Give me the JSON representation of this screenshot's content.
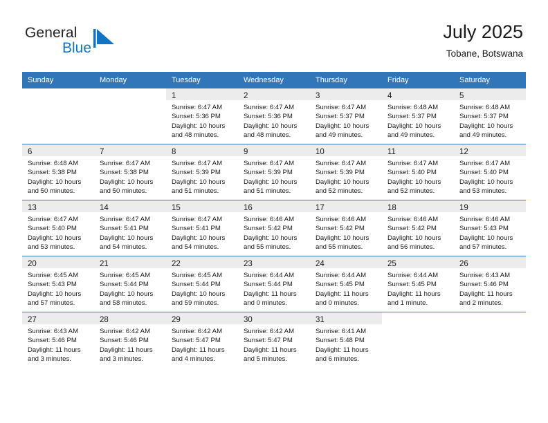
{
  "brand": {
    "name_top": "General",
    "name_bottom": "Blue",
    "color_top": "#231f20",
    "color_bottom": "#1474c4",
    "mark_color": "#1474c4"
  },
  "header": {
    "title": "July 2025",
    "subtitle": "Tobane, Botswana"
  },
  "theme": {
    "header_bg": "#3176b9",
    "header_text": "#ffffff",
    "daynum_band_bg": "#ececec",
    "row_divider": "#3176b9",
    "body_text": "#1a1a1a"
  },
  "weekdays": [
    "Sunday",
    "Monday",
    "Tuesday",
    "Wednesday",
    "Thursday",
    "Friday",
    "Saturday"
  ],
  "weeks": [
    [
      {
        "day": "",
        "sunrise": "",
        "sunset": "",
        "daylight_1": "",
        "daylight_2": ""
      },
      {
        "day": "",
        "sunrise": "",
        "sunset": "",
        "daylight_1": "",
        "daylight_2": ""
      },
      {
        "day": "1",
        "sunrise": "Sunrise: 6:47 AM",
        "sunset": "Sunset: 5:36 PM",
        "daylight_1": "Daylight: 10 hours",
        "daylight_2": "and 48 minutes."
      },
      {
        "day": "2",
        "sunrise": "Sunrise: 6:47 AM",
        "sunset": "Sunset: 5:36 PM",
        "daylight_1": "Daylight: 10 hours",
        "daylight_2": "and 48 minutes."
      },
      {
        "day": "3",
        "sunrise": "Sunrise: 6:47 AM",
        "sunset": "Sunset: 5:37 PM",
        "daylight_1": "Daylight: 10 hours",
        "daylight_2": "and 49 minutes."
      },
      {
        "day": "4",
        "sunrise": "Sunrise: 6:48 AM",
        "sunset": "Sunset: 5:37 PM",
        "daylight_1": "Daylight: 10 hours",
        "daylight_2": "and 49 minutes."
      },
      {
        "day": "5",
        "sunrise": "Sunrise: 6:48 AM",
        "sunset": "Sunset: 5:37 PM",
        "daylight_1": "Daylight: 10 hours",
        "daylight_2": "and 49 minutes."
      }
    ],
    [
      {
        "day": "6",
        "sunrise": "Sunrise: 6:48 AM",
        "sunset": "Sunset: 5:38 PM",
        "daylight_1": "Daylight: 10 hours",
        "daylight_2": "and 50 minutes."
      },
      {
        "day": "7",
        "sunrise": "Sunrise: 6:47 AM",
        "sunset": "Sunset: 5:38 PM",
        "daylight_1": "Daylight: 10 hours",
        "daylight_2": "and 50 minutes."
      },
      {
        "day": "8",
        "sunrise": "Sunrise: 6:47 AM",
        "sunset": "Sunset: 5:39 PM",
        "daylight_1": "Daylight: 10 hours",
        "daylight_2": "and 51 minutes."
      },
      {
        "day": "9",
        "sunrise": "Sunrise: 6:47 AM",
        "sunset": "Sunset: 5:39 PM",
        "daylight_1": "Daylight: 10 hours",
        "daylight_2": "and 51 minutes."
      },
      {
        "day": "10",
        "sunrise": "Sunrise: 6:47 AM",
        "sunset": "Sunset: 5:39 PM",
        "daylight_1": "Daylight: 10 hours",
        "daylight_2": "and 52 minutes."
      },
      {
        "day": "11",
        "sunrise": "Sunrise: 6:47 AM",
        "sunset": "Sunset: 5:40 PM",
        "daylight_1": "Daylight: 10 hours",
        "daylight_2": "and 52 minutes."
      },
      {
        "day": "12",
        "sunrise": "Sunrise: 6:47 AM",
        "sunset": "Sunset: 5:40 PM",
        "daylight_1": "Daylight: 10 hours",
        "daylight_2": "and 53 minutes."
      }
    ],
    [
      {
        "day": "13",
        "sunrise": "Sunrise: 6:47 AM",
        "sunset": "Sunset: 5:40 PM",
        "daylight_1": "Daylight: 10 hours",
        "daylight_2": "and 53 minutes."
      },
      {
        "day": "14",
        "sunrise": "Sunrise: 6:47 AM",
        "sunset": "Sunset: 5:41 PM",
        "daylight_1": "Daylight: 10 hours",
        "daylight_2": "and 54 minutes."
      },
      {
        "day": "15",
        "sunrise": "Sunrise: 6:47 AM",
        "sunset": "Sunset: 5:41 PM",
        "daylight_1": "Daylight: 10 hours",
        "daylight_2": "and 54 minutes."
      },
      {
        "day": "16",
        "sunrise": "Sunrise: 6:46 AM",
        "sunset": "Sunset: 5:42 PM",
        "daylight_1": "Daylight: 10 hours",
        "daylight_2": "and 55 minutes."
      },
      {
        "day": "17",
        "sunrise": "Sunrise: 6:46 AM",
        "sunset": "Sunset: 5:42 PM",
        "daylight_1": "Daylight: 10 hours",
        "daylight_2": "and 55 minutes."
      },
      {
        "day": "18",
        "sunrise": "Sunrise: 6:46 AM",
        "sunset": "Sunset: 5:42 PM",
        "daylight_1": "Daylight: 10 hours",
        "daylight_2": "and 56 minutes."
      },
      {
        "day": "19",
        "sunrise": "Sunrise: 6:46 AM",
        "sunset": "Sunset: 5:43 PM",
        "daylight_1": "Daylight: 10 hours",
        "daylight_2": "and 57 minutes."
      }
    ],
    [
      {
        "day": "20",
        "sunrise": "Sunrise: 6:45 AM",
        "sunset": "Sunset: 5:43 PM",
        "daylight_1": "Daylight: 10 hours",
        "daylight_2": "and 57 minutes."
      },
      {
        "day": "21",
        "sunrise": "Sunrise: 6:45 AM",
        "sunset": "Sunset: 5:44 PM",
        "daylight_1": "Daylight: 10 hours",
        "daylight_2": "and 58 minutes."
      },
      {
        "day": "22",
        "sunrise": "Sunrise: 6:45 AM",
        "sunset": "Sunset: 5:44 PM",
        "daylight_1": "Daylight: 10 hours",
        "daylight_2": "and 59 minutes."
      },
      {
        "day": "23",
        "sunrise": "Sunrise: 6:44 AM",
        "sunset": "Sunset: 5:44 PM",
        "daylight_1": "Daylight: 11 hours",
        "daylight_2": "and 0 minutes."
      },
      {
        "day": "24",
        "sunrise": "Sunrise: 6:44 AM",
        "sunset": "Sunset: 5:45 PM",
        "daylight_1": "Daylight: 11 hours",
        "daylight_2": "and 0 minutes."
      },
      {
        "day": "25",
        "sunrise": "Sunrise: 6:44 AM",
        "sunset": "Sunset: 5:45 PM",
        "daylight_1": "Daylight: 11 hours",
        "daylight_2": "and 1 minute."
      },
      {
        "day": "26",
        "sunrise": "Sunrise: 6:43 AM",
        "sunset": "Sunset: 5:46 PM",
        "daylight_1": "Daylight: 11 hours",
        "daylight_2": "and 2 minutes."
      }
    ],
    [
      {
        "day": "27",
        "sunrise": "Sunrise: 6:43 AM",
        "sunset": "Sunset: 5:46 PM",
        "daylight_1": "Daylight: 11 hours",
        "daylight_2": "and 3 minutes."
      },
      {
        "day": "28",
        "sunrise": "Sunrise: 6:42 AM",
        "sunset": "Sunset: 5:46 PM",
        "daylight_1": "Daylight: 11 hours",
        "daylight_2": "and 3 minutes."
      },
      {
        "day": "29",
        "sunrise": "Sunrise: 6:42 AM",
        "sunset": "Sunset: 5:47 PM",
        "daylight_1": "Daylight: 11 hours",
        "daylight_2": "and 4 minutes."
      },
      {
        "day": "30",
        "sunrise": "Sunrise: 6:42 AM",
        "sunset": "Sunset: 5:47 PM",
        "daylight_1": "Daylight: 11 hours",
        "daylight_2": "and 5 minutes."
      },
      {
        "day": "31",
        "sunrise": "Sunrise: 6:41 AM",
        "sunset": "Sunset: 5:48 PM",
        "daylight_1": "Daylight: 11 hours",
        "daylight_2": "and 6 minutes."
      },
      {
        "day": "",
        "sunrise": "",
        "sunset": "",
        "daylight_1": "",
        "daylight_2": ""
      },
      {
        "day": "",
        "sunrise": "",
        "sunset": "",
        "daylight_1": "",
        "daylight_2": ""
      }
    ]
  ]
}
